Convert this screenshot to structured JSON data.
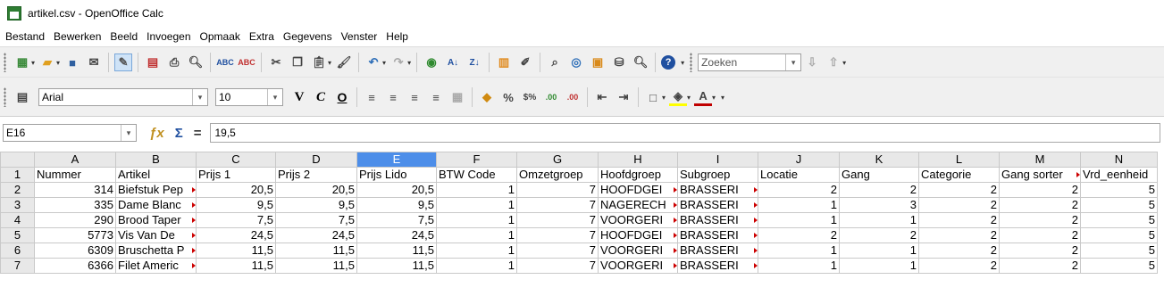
{
  "window": {
    "title": "artikel.csv - OpenOffice Calc"
  },
  "menu": [
    "Bestand",
    "Bewerken",
    "Beeld",
    "Invoegen",
    "Opmaak",
    "Extra",
    "Gegevens",
    "Venster",
    "Help"
  ],
  "toolbar1": {
    "search_value": "Zoeken"
  },
  "toolbar2": {
    "font_name": "Arial",
    "font_size": "10"
  },
  "formula_bar": {
    "cell_ref": "E16",
    "content": "19,5"
  },
  "sheet": {
    "corner": "",
    "columns": [
      "A",
      "B",
      "C",
      "D",
      "E",
      "F",
      "G",
      "H",
      "I",
      "J",
      "K",
      "L",
      "M",
      "N"
    ],
    "selected_column": "E",
    "rows": [
      {
        "n": "1",
        "cells": [
          "Nummer",
          "Artikel",
          "Prijs 1",
          "Prijs 2",
          "Prijs Lido",
          "BTW Code",
          "Omzetgroep",
          "Hoofdgroep",
          "Subgroep",
          "Locatie",
          "Gang",
          "Categorie",
          "Gang sorter",
          "Vrd_eenheid"
        ]
      },
      {
        "n": "2",
        "cells": [
          "314",
          "Biefstuk Pep",
          "20,5",
          "20,5",
          "20,5",
          "1",
          "7",
          "HOOFDGEI",
          "BRASSERI",
          "2",
          "2",
          "2",
          "2",
          "5"
        ]
      },
      {
        "n": "3",
        "cells": [
          "335",
          "Dame Blanc",
          "9,5",
          "9,5",
          "9,5",
          "1",
          "7",
          "NAGERECH",
          "BRASSERI",
          "1",
          "3",
          "2",
          "2",
          "5"
        ]
      },
      {
        "n": "4",
        "cells": [
          "290",
          "Brood Taper",
          "7,5",
          "7,5",
          "7,5",
          "1",
          "7",
          "VOORGERI",
          "BRASSERI",
          "1",
          "1",
          "2",
          "2",
          "5"
        ]
      },
      {
        "n": "5",
        "cells": [
          "5773",
          "Vis Van De",
          "24,5",
          "24,5",
          "24,5",
          "1",
          "7",
          "HOOFDGEI",
          "BRASSERI",
          "2",
          "2",
          "2",
          "2",
          "5"
        ]
      },
      {
        "n": "6",
        "cells": [
          "6309",
          "Bruschetta P",
          "11,5",
          "11,5",
          "11,5",
          "1",
          "7",
          "VOORGERI",
          "BRASSERI",
          "1",
          "1",
          "2",
          "2",
          "5"
        ]
      },
      {
        "n": "7",
        "cells": [
          "6366",
          "Filet Americ",
          "11,5",
          "11,5",
          "11,5",
          "1",
          "7",
          "VOORGERI",
          "BRASSERI",
          "1",
          "1",
          "2",
          "2",
          "5"
        ]
      }
    ]
  }
}
